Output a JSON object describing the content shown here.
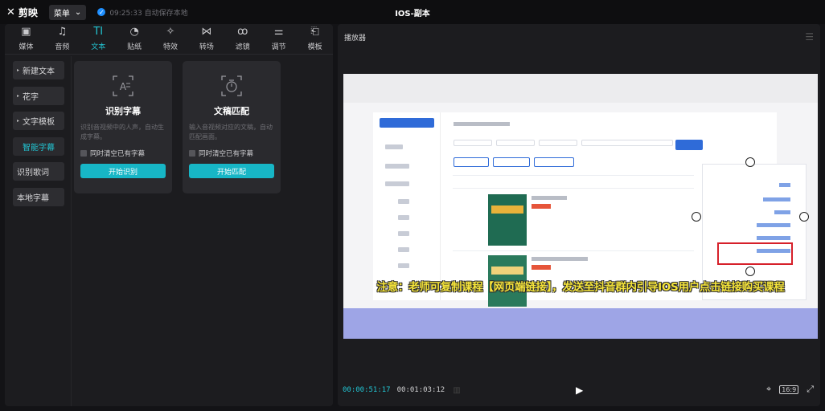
{
  "app": {
    "logo": "剪映",
    "menu_label": "菜单",
    "autosave": "09:25:33 自动保存本地",
    "doc_title": "IOS-副本"
  },
  "tabs": [
    {
      "label": "媒体",
      "icon": "media-icon",
      "glyph": "▣"
    },
    {
      "label": "音频",
      "icon": "audio-icon",
      "glyph": "♫"
    },
    {
      "label": "文本",
      "icon": "text-icon",
      "glyph": "TI",
      "active": true
    },
    {
      "label": "贴纸",
      "icon": "sticker-icon",
      "glyph": "◔"
    },
    {
      "label": "特效",
      "icon": "effects-icon",
      "glyph": "✧"
    },
    {
      "label": "转场",
      "icon": "transition-icon",
      "glyph": "⋈"
    },
    {
      "label": "滤镜",
      "icon": "filter-icon",
      "glyph": "ꝏ"
    },
    {
      "label": "调节",
      "icon": "adjust-icon",
      "glyph": "⚌"
    },
    {
      "label": "模板",
      "icon": "template-icon",
      "glyph": "⎗"
    }
  ],
  "categories": [
    {
      "label": "新建文本",
      "arrow": "▸"
    },
    {
      "label": "花字",
      "arrow": "▸"
    },
    {
      "label": "文字模板",
      "arrow": "▸"
    },
    {
      "label": "智能字幕",
      "arrow": ""
    },
    {
      "label": "识别歌词",
      "arrow": ""
    },
    {
      "label": "本地字幕",
      "arrow": ""
    }
  ],
  "cards": [
    {
      "title": "识别字幕",
      "desc": "识别音视频中的人声，自动生成字幕。",
      "checkbox": "同时清空已有字幕",
      "button": "开始识别"
    },
    {
      "title": "文稿匹配",
      "desc": "输入音视频对应的文稿，自动匹配画面。",
      "checkbox": "同时清空已有字幕",
      "button": "开始匹配"
    }
  ],
  "player": {
    "title": "播放器",
    "caption": "注意：老师可复制课程【网页端链接】，发送至抖音群内引导IOS用户点击链接购买课程",
    "current_time": "00:00:51:17",
    "total_time": "00:01:03:12",
    "ratio": "16:9"
  },
  "colors": {
    "accent": "#22c4d2",
    "button": "#17b6c6",
    "caption": "#f6e53a",
    "highlight": "#d6202a"
  }
}
